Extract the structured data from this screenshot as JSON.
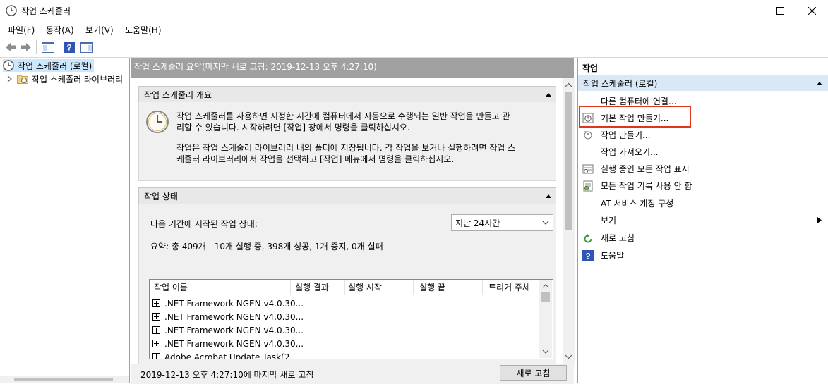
{
  "window": {
    "title": "작업 스케줄러",
    "minimize": "–",
    "maximize": "☐",
    "close": "✕"
  },
  "menu": [
    "파일(F)",
    "동작(A)",
    "보기(V)",
    "도움말(H)"
  ],
  "tree": {
    "root": "작업 스케줄러 (로컬)",
    "child": "작업 스케줄러 라이브러리"
  },
  "center": {
    "header": "작업 스케줄러 요약(마지막 새로 고침: 2019-12-13 오후 4:27:10)",
    "overview": {
      "title": "작업 스케줄러 개요",
      "para1_line1": "작업 스케줄러를 사용하면 지정한 시간에 컴퓨터에서 자동으로 수행되는 일반 작업을 만들고 관",
      "para1_line2": "리할 수 있습니다. 시작하려면 [작업] 창에서 명령을 클릭하십시오.",
      "para2_line1": "작업은 작업 스케줄러 라이브러리 내의 폴더에 저장됩니다. 각 작업을 보거나 실행하려면 작업 스",
      "para2_line2": "케줄러 라이브러리에서 작업을 선택하고 [작업] 메뉴에서 명령을 클릭하십시오."
    },
    "status": {
      "title": "작업 상태",
      "period_label": "다음 기간에 시작된 작업 상태:",
      "period_value": "지난 24시간",
      "summary": "요약: 총 409개 - 10개 실행 중, 398개 성공, 1개 중지, 0개 실패",
      "columns": [
        "작업 이름",
        "실행 결과",
        "실행 시작",
        "실행 끝",
        "트리거 주체"
      ],
      "rows": [
        ".NET Framework NGEN v4.0.30...",
        ".NET Framework NGEN v4.0.30...",
        ".NET Framework NGEN v4.0.30...",
        ".NET Framework NGEN v4.0.30...",
        "Adobe Acrobat Update Task(2..."
      ]
    },
    "footer": {
      "last_refresh": "2019-12-13 오후 4:27:10에 마지막 새로 고침",
      "refresh_button": "새로 고침"
    }
  },
  "actions": {
    "header": "작업",
    "group": "작업 스케줄러 (로컬)",
    "items": [
      "다른 컴퓨터에 연결...",
      "기본 작업 만들기...",
      "작업 만들기...",
      "작업 가져오기...",
      "실행 중인 모든 작업 표시",
      "모든 작업 기록 사용 안 함",
      "AT 서비스 계정 구성",
      "보기",
      "새로 고침",
      "도움말"
    ]
  },
  "colors": {
    "highlight_border": "#e2341d",
    "selection_bg": "#cce8ff",
    "group_bg": "#d9e8f7"
  }
}
